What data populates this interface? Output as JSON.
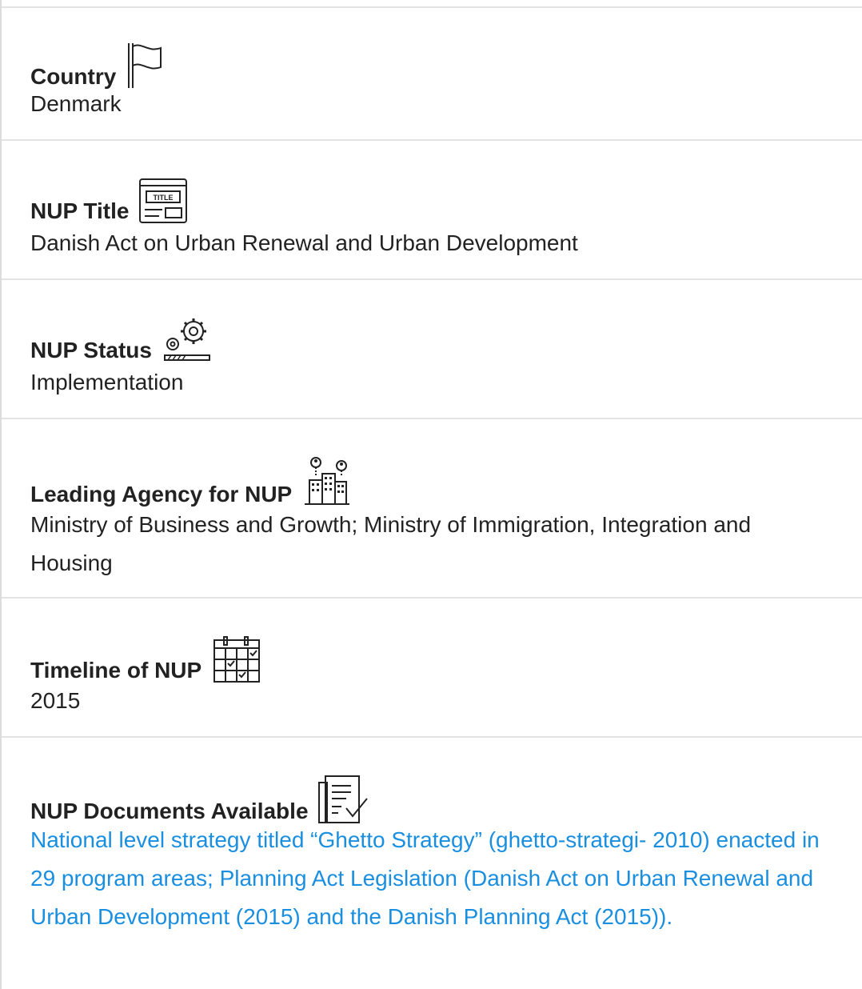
{
  "sections": [
    {
      "label": "Country",
      "value": "Denmark",
      "icon": "flag-icon"
    },
    {
      "label": "NUP Title",
      "value": "Danish Act on Urban Renewal and Urban Development",
      "icon": "title-window-icon"
    },
    {
      "label": "NUP Status",
      "value": "Implementation",
      "icon": "gears-progress-icon"
    },
    {
      "label": "Leading Agency for NUP",
      "value": "Ministry of Business and Growth; Ministry of Immigration, Integration and Housing",
      "icon": "city-agency-icon"
    },
    {
      "label": "Timeline of NUP",
      "value": "2015",
      "icon": "calendar-icon"
    },
    {
      "label": "NUP Documents Available",
      "value": "National level strategy titled “Ghetto Strategy” (ghetto-strategi- 2010) enacted in 29 program areas; Planning Act Legislation (Danish Act on Urban Renewal and Urban Development (2015) and the Danish Planning Act (2015)).",
      "icon": "document-check-icon"
    }
  ],
  "colors": {
    "text": "#222222",
    "link": "#1a8fe0",
    "divider": "#e3e3e3"
  }
}
